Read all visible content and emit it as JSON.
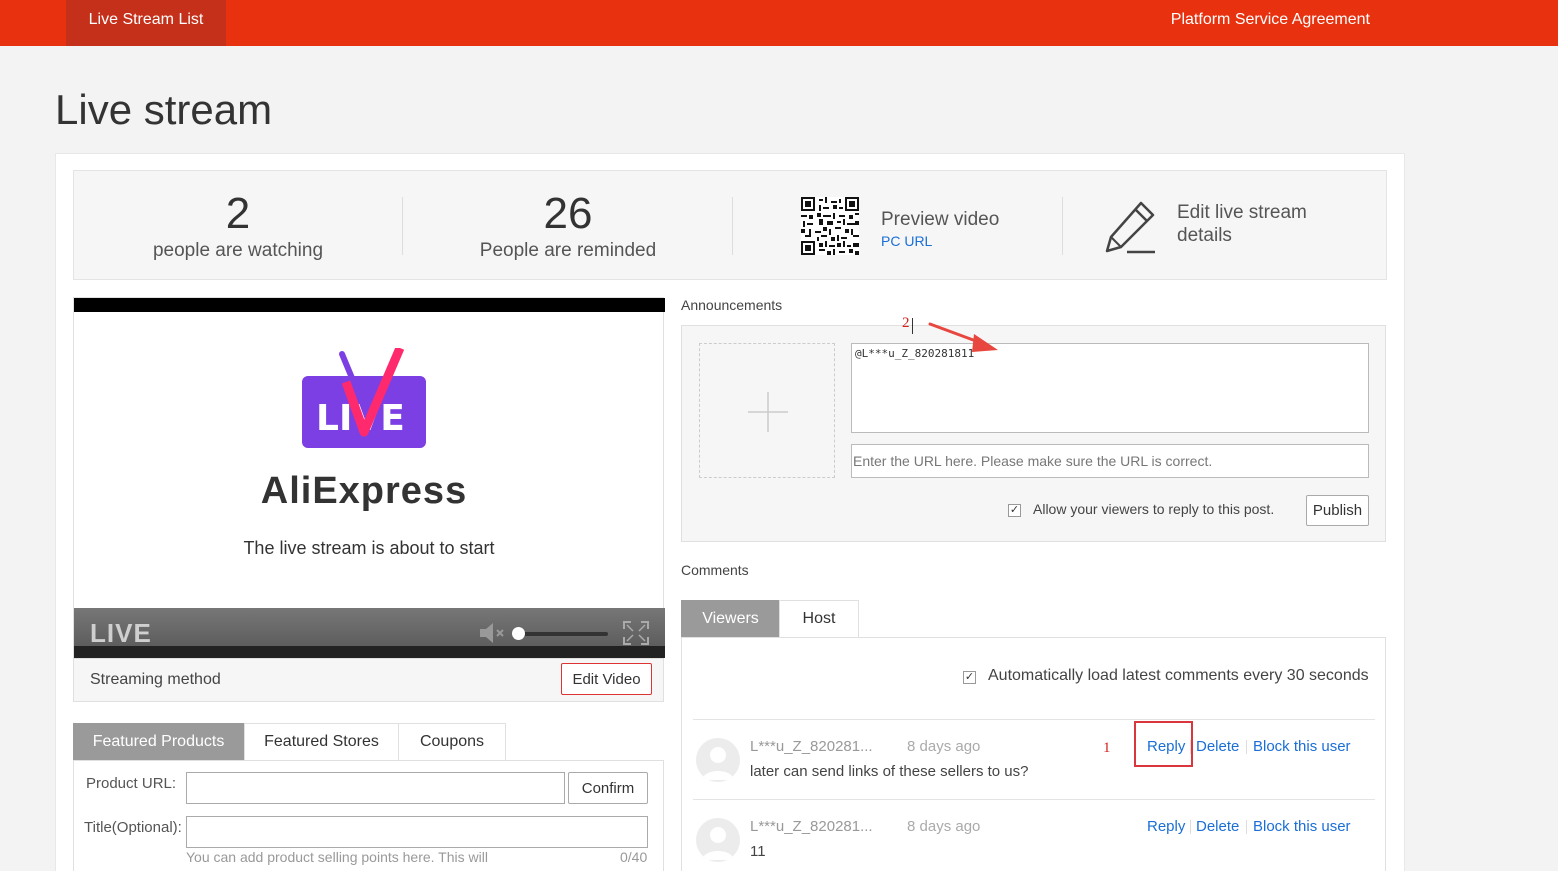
{
  "topbar": {
    "tab_label": "Live Stream List",
    "agreement_label": "Platform Service Agreement",
    "color": "#e8320f"
  },
  "page": {
    "title": "Live stream"
  },
  "stats": {
    "watching": {
      "value": "2",
      "label": "people are watching"
    },
    "reminded": {
      "value": "26",
      "label": "People are reminded"
    },
    "preview": {
      "title": "Preview video",
      "link": "PC URL"
    },
    "edit": {
      "label": "Edit live stream details"
    }
  },
  "player": {
    "brand": "AliExpress",
    "logo_text": "LIVE",
    "status": "The live stream is about to start",
    "live_tag": "LIVE",
    "streaming_label": "Streaming method",
    "edit_video_label": "Edit Video"
  },
  "products": {
    "tabs": [
      "Featured Products",
      "Featured Stores",
      "Coupons"
    ],
    "product_url_label": "Product URL:",
    "confirm_label": "Confirm",
    "title_label": "Title(Optional):",
    "hint": "You can add product selling points here. This will",
    "count": "0/40"
  },
  "announcements": {
    "label": "Announcements",
    "text": "@L***u_Z_820281811",
    "url_placeholder": "Enter the URL here. Please make sure the URL is correct.",
    "allow_label": "Allow your viewers to reply to this post.",
    "publish_label": "Publish",
    "annotation": "2"
  },
  "comments": {
    "label": "Comments",
    "tabs": [
      "Viewers",
      "Host"
    ],
    "auto_label": "Automatically load latest comments every 30 seconds",
    "annotation": "1",
    "actions": {
      "reply": "Reply",
      "delete": "Delete",
      "block": "Block this user"
    },
    "items": [
      {
        "name": "L***u_Z_820281...",
        "ago": "8 days ago",
        "text": "later can send links of these sellers to us?"
      },
      {
        "name": "L***u_Z_820281...",
        "ago": "8 days ago",
        "text": "11"
      }
    ]
  }
}
